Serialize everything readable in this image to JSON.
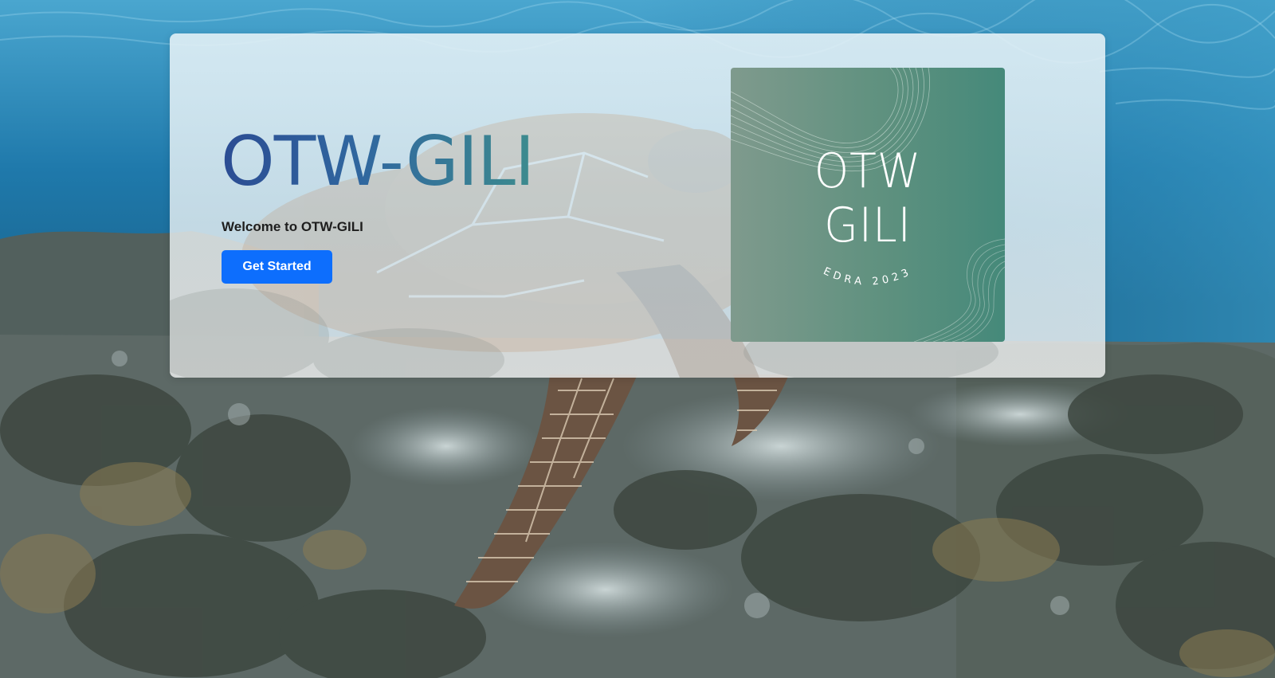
{
  "hero": {
    "title": "OTW-GILI",
    "welcome_text": "Welcome to OTW-GILI",
    "cta_label": "Get Started"
  },
  "logo": {
    "line1": "OTW",
    "line2": "GILI",
    "tagline": "EDRA 2023"
  },
  "colors": {
    "cta": "#0d6efd",
    "title_gradient_start": "#2b4c93",
    "title_gradient_end": "#3d8b8e",
    "logo_bg": "#5f917f",
    "water": "#1a6e9e"
  },
  "icons": {
    "background": "underwater-turtle-reef-photo"
  }
}
